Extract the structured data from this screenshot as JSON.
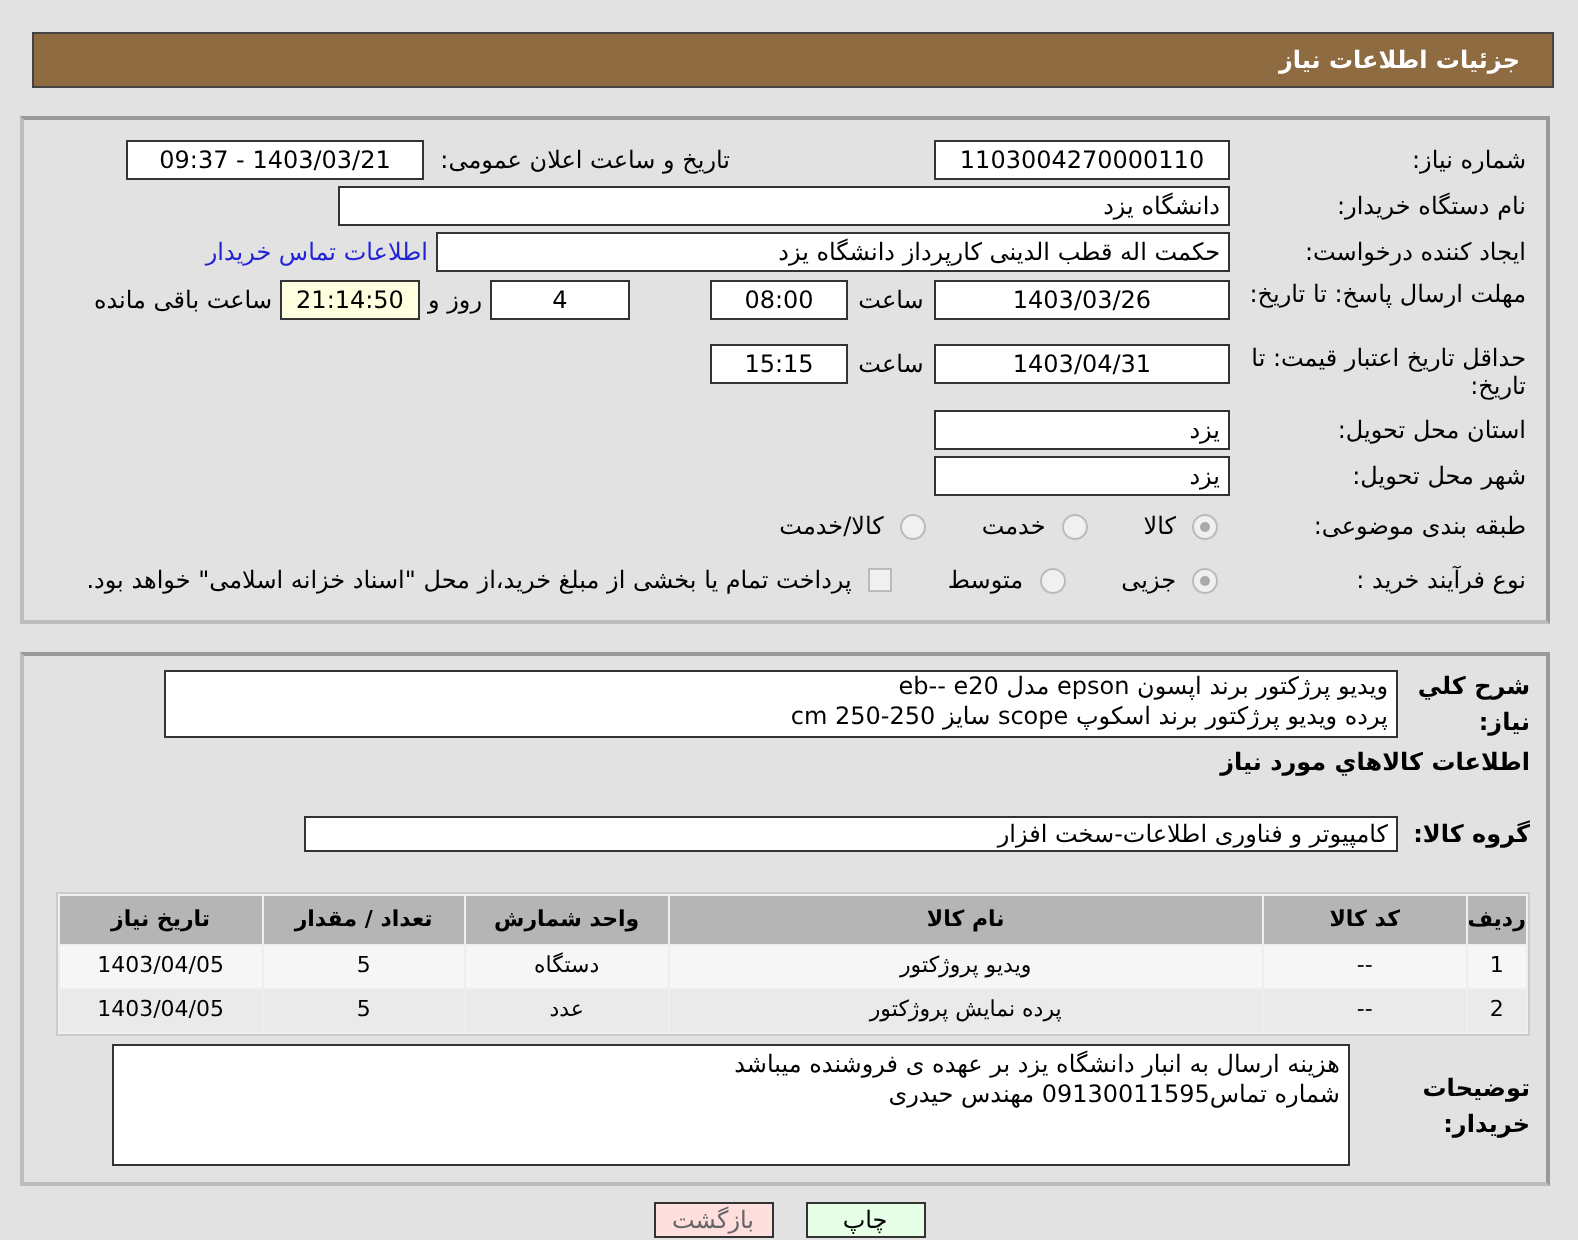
{
  "header": {
    "title": "جزئیات اطلاعات نیاز"
  },
  "need_number": {
    "label": "شماره نیاز:",
    "value": "1103004270000110"
  },
  "announce": {
    "label": "تاریخ و ساعت اعلان عمومی:",
    "value": "1403/03/21 - 09:37"
  },
  "buyer_org": {
    "label": "نام دستگاه خریدار:",
    "value": "دانشگاه یزد"
  },
  "requester": {
    "label": "ایجاد کننده درخواست:",
    "value": "حکمت اله قطب الدینی کارپرداز دانشگاه یزد",
    "link": "اطلاعات تماس خریدار"
  },
  "reply_deadline": {
    "label": "مهلت ارسال پاسخ: تا تاریخ:",
    "date": "1403/03/26",
    "time_label": "ساعت",
    "time": "08:00",
    "days": "4",
    "days_label": "روز و",
    "remaining": "21:14:50",
    "remaining_label": "ساعت باقی مانده"
  },
  "price_validity": {
    "label": "حداقل تاریخ اعتبار قیمت: تا تاریخ:",
    "date": "1403/04/31",
    "time_label": "ساعت",
    "time": "15:15"
  },
  "province": {
    "label": "استان محل تحویل:",
    "value": "یزد"
  },
  "city": {
    "label": "شهر محل تحویل:",
    "value": "یزد"
  },
  "category": {
    "label": "طبقه بندی موضوعی:",
    "options": [
      {
        "label": "کالا",
        "selected": true
      },
      {
        "label": "خدمت",
        "selected": false
      },
      {
        "label": "کالا/خدمت",
        "selected": false
      }
    ]
  },
  "process": {
    "label": "نوع فرآیند خرید :",
    "options": [
      {
        "label": "جزیی",
        "selected": true
      },
      {
        "label": "متوسط",
        "selected": false
      }
    ],
    "treasury": {
      "label": "پرداخت تمام یا بخشی از مبلغ خرید،از محل \"اسناد خزانه اسلامی\" خواهد بود.",
      "checked": false
    }
  },
  "description": {
    "label": "شرح کلي نياز:",
    "lines": [
      "ویدیو پرژکتور برند اپسون epson مدل eb-- e20",
      "پرده  ویدیو پرژکتور  برند اسکوپ scope سایز 250-250 cm"
    ]
  },
  "goods_heading": "اطلاعات کالاهاي مورد نياز",
  "goods_group": {
    "label": "گروه کالا:",
    "value": "کامپیوتر و فناوری اطلاعات-سخت افزار"
  },
  "table": {
    "columns": [
      "ردیف",
      "کد کالا",
      "نام کالا",
      "واحد شمارش",
      "تعداد / مقدار",
      "تاریخ نیاز"
    ],
    "rows": [
      [
        "1",
        "--",
        "ویدیو پروژکتور",
        "دستگاه",
        "5",
        "1403/04/05"
      ],
      [
        "2",
        "--",
        "پرده نمایش پروژکتور",
        "عدد",
        "5",
        "1403/04/05"
      ]
    ]
  },
  "buyer_notes": {
    "label": "توضیحات خریدار:",
    "lines": [
      "هزینه ارسال به انبار دانشگاه یزد بر  عهده ی فروشنده میباشد",
      "شماره تماس09130011595 مهندس حیدری"
    ]
  },
  "buttons": [
    {
      "label": "چاپ",
      "kind": "print"
    },
    {
      "label": "بازگشت",
      "kind": "back"
    }
  ]
}
